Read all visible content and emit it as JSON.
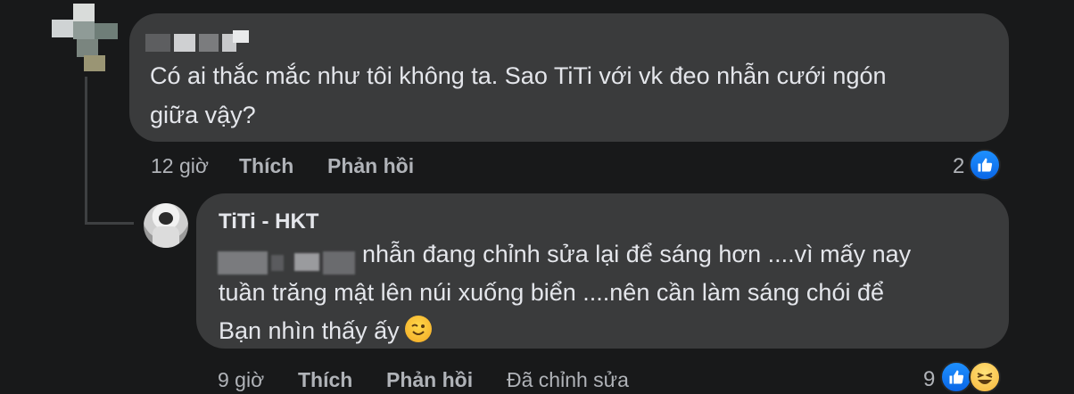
{
  "comment": {
    "text": "Có ai thắc mắc như tôi không ta. Sao TiTi với vk đeo nhẫn cưới ngón giữa vậy?",
    "line1": "Có ai thắc mắc như tôi không ta. Sao TiTi với vk đeo nhẫn cưới ngón",
    "line2": "giữa vậy?",
    "time": "12 giờ",
    "like_label": "Thích",
    "reply_label": "Phản hồi",
    "reaction_count": "2"
  },
  "reply": {
    "author": "TiTi - HKT",
    "line1": "nhẫn đang chỉnh sửa lại để sáng hơn ....vì mấy nay",
    "line2": "tuần trăng mật lên núi xuống biển ....nên cần làm sáng chói để",
    "line3": "Bạn nhìn thấy ấy",
    "time": "9 giờ",
    "like_label": "Thích",
    "reply_label": "Phản hồi",
    "edited_label": "Đã chỉnh sửa",
    "reaction_count": "9"
  },
  "colors": {
    "background": "#18191a",
    "bubble": "#3a3b3c",
    "text": "#e4e6eb",
    "meta": "#b0b3b8",
    "like_blue": "#1877f2"
  }
}
